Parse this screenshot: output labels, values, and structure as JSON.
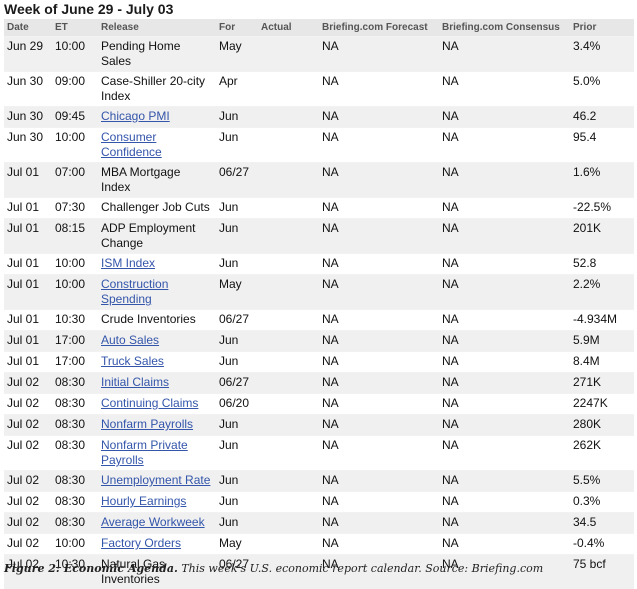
{
  "week_title": "Week of June 29 - July 03",
  "columns": [
    "Date",
    "ET",
    "Release",
    "For",
    "Actual",
    "Briefing.com Forecast",
    "Briefing.com Consensus",
    "Prior"
  ],
  "rows": [
    {
      "date": "Jun 29",
      "et": "10:00",
      "release": "Pending Home Sales",
      "link": false,
      "for": "May",
      "actual": "",
      "forecast": "NA",
      "consensus": "NA",
      "prior": "3.4%"
    },
    {
      "date": "Jun 30",
      "et": "09:00",
      "release": "Case-Shiller 20-city Index",
      "link": false,
      "for": "Apr",
      "actual": "",
      "forecast": "NA",
      "consensus": "NA",
      "prior": "5.0%"
    },
    {
      "date": "Jun 30",
      "et": "09:45",
      "release": "Chicago PMI",
      "link": true,
      "for": "Jun",
      "actual": "",
      "forecast": "NA",
      "consensus": "NA",
      "prior": "46.2"
    },
    {
      "date": "Jun 30",
      "et": "10:00",
      "release": "Consumer Confidence",
      "link": true,
      "for": "Jun",
      "actual": "",
      "forecast": "NA",
      "consensus": "NA",
      "prior": "95.4"
    },
    {
      "date": "Jul 01",
      "et": "07:00",
      "release": "MBA Mortgage Index",
      "link": false,
      "for": "06/27",
      "actual": "",
      "forecast": "NA",
      "consensus": "NA",
      "prior": "1.6%"
    },
    {
      "date": "Jul 01",
      "et": "07:30",
      "release": "Challenger Job Cuts",
      "link": false,
      "for": "Jun",
      "actual": "",
      "forecast": "NA",
      "consensus": "NA",
      "prior": "-22.5%"
    },
    {
      "date": "Jul 01",
      "et": "08:15",
      "release": "ADP Employment Change",
      "link": false,
      "for": "Jun",
      "actual": "",
      "forecast": "NA",
      "consensus": "NA",
      "prior": "201K"
    },
    {
      "date": "Jul 01",
      "et": "10:00",
      "release": "ISM Index",
      "link": true,
      "for": "Jun",
      "actual": "",
      "forecast": "NA",
      "consensus": "NA",
      "prior": "52.8"
    },
    {
      "date": "Jul 01",
      "et": "10:00",
      "release": "Construction Spending",
      "link": true,
      "for": "May",
      "actual": "",
      "forecast": "NA",
      "consensus": "NA",
      "prior": "2.2%"
    },
    {
      "date": "Jul 01",
      "et": "10:30",
      "release": "Crude Inventories",
      "link": false,
      "for": "06/27",
      "actual": "",
      "forecast": "NA",
      "consensus": "NA",
      "prior": "-4.934M"
    },
    {
      "date": "Jul 01",
      "et": "17:00",
      "release": "Auto Sales",
      "link": true,
      "for": "Jun",
      "actual": "",
      "forecast": "NA",
      "consensus": "NA",
      "prior": "5.9M"
    },
    {
      "date": "Jul 01",
      "et": "17:00",
      "release": "Truck Sales",
      "link": true,
      "for": "Jun",
      "actual": "",
      "forecast": "NA",
      "consensus": "NA",
      "prior": "8.4M"
    },
    {
      "date": "Jul 02",
      "et": "08:30",
      "release": "Initial Claims",
      "link": true,
      "for": "06/27",
      "actual": "",
      "forecast": "NA",
      "consensus": "NA",
      "prior": "271K"
    },
    {
      "date": "Jul 02",
      "et": "08:30",
      "release": "Continuing Claims",
      "link": true,
      "for": "06/20",
      "actual": "",
      "forecast": "NA",
      "consensus": "NA",
      "prior": "2247K"
    },
    {
      "date": "Jul 02",
      "et": "08:30",
      "release": "Nonfarm Payrolls",
      "link": true,
      "for": "Jun",
      "actual": "",
      "forecast": "NA",
      "consensus": "NA",
      "prior": "280K"
    },
    {
      "date": "Jul 02",
      "et": "08:30",
      "release": "Nonfarm Private Payrolls",
      "link": true,
      "for": "Jun",
      "actual": "",
      "forecast": "NA",
      "consensus": "NA",
      "prior": "262K"
    },
    {
      "date": "Jul 02",
      "et": "08:30",
      "release": "Unemployment Rate",
      "link": true,
      "for": "Jun",
      "actual": "",
      "forecast": "NA",
      "consensus": "NA",
      "prior": "5.5%"
    },
    {
      "date": "Jul 02",
      "et": "08:30",
      "release": "Hourly Earnings",
      "link": true,
      "for": "Jun",
      "actual": "",
      "forecast": "NA",
      "consensus": "NA",
      "prior": "0.3%"
    },
    {
      "date": "Jul 02",
      "et": "08:30",
      "release": "Average Workweek",
      "link": true,
      "for": "Jun",
      "actual": "",
      "forecast": "NA",
      "consensus": "NA",
      "prior": "34.5"
    },
    {
      "date": "Jul 02",
      "et": "10:00",
      "release": "Factory Orders",
      "link": true,
      "for": "May",
      "actual": "",
      "forecast": "NA",
      "consensus": "NA",
      "prior": "-0.4%"
    },
    {
      "date": "Jul 02",
      "et": "10:30",
      "release": "Natural Gas Inventories",
      "link": false,
      "for": "06/27",
      "actual": "",
      "forecast": "NA",
      "consensus": "NA",
      "prior": "75 bcf"
    }
  ],
  "caption": {
    "label": "Figure 2: Economic Agenda.",
    "text": " This week's U.S. economic report calendar. Source: Briefing.com"
  }
}
